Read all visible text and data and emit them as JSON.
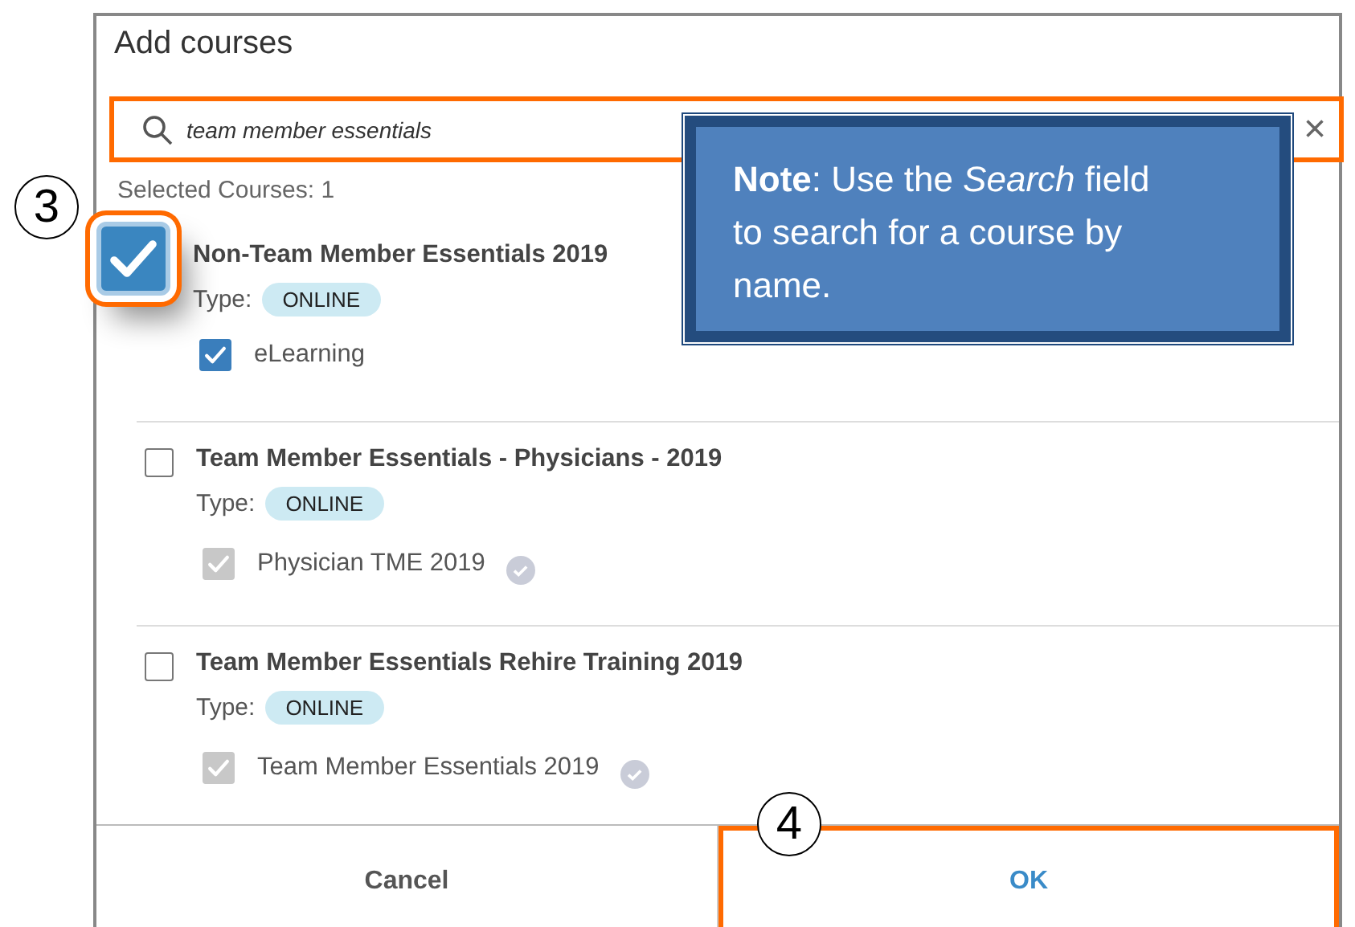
{
  "dialog": {
    "title": "Add courses",
    "search": {
      "value": "team member essentials",
      "clear": "×"
    },
    "selected_count": "Selected Courses: 1",
    "courses": [
      {
        "title": "Non-Team Member Essentials 2019",
        "selected": true,
        "highlighted": true,
        "type_label": "Type:",
        "type": "ONLINE",
        "items": [
          {
            "label": "eLearning",
            "checked": true,
            "disabled": false,
            "verified": false
          }
        ]
      },
      {
        "title": "Team Member Essentials - Physicians - 2019",
        "selected": false,
        "highlighted": false,
        "type_label": "Type:",
        "type": "ONLINE",
        "items": [
          {
            "label": "Physician TME 2019",
            "checked": true,
            "disabled": true,
            "verified": true
          }
        ]
      },
      {
        "title": "Team Member Essentials Rehire Training 2019",
        "selected": false,
        "highlighted": false,
        "type_label": "Type:",
        "type": "ONLINE",
        "items": [
          {
            "label": "Team Member Essentials 2019",
            "checked": true,
            "disabled": true,
            "verified": true
          }
        ]
      }
    ],
    "buttons": [
      {
        "label": "Cancel",
        "kind": "cancel",
        "highlighted": false
      },
      {
        "label": "OK",
        "kind": "primary",
        "highlighted": true
      }
    ]
  },
  "annotations": {
    "note": "**Note**: Use the *Search* field to search for a course by name.",
    "steps": [
      {
        "number": "3",
        "kind": "checkbox"
      },
      {
        "number": "4",
        "kind": "ok"
      }
    ]
  }
}
